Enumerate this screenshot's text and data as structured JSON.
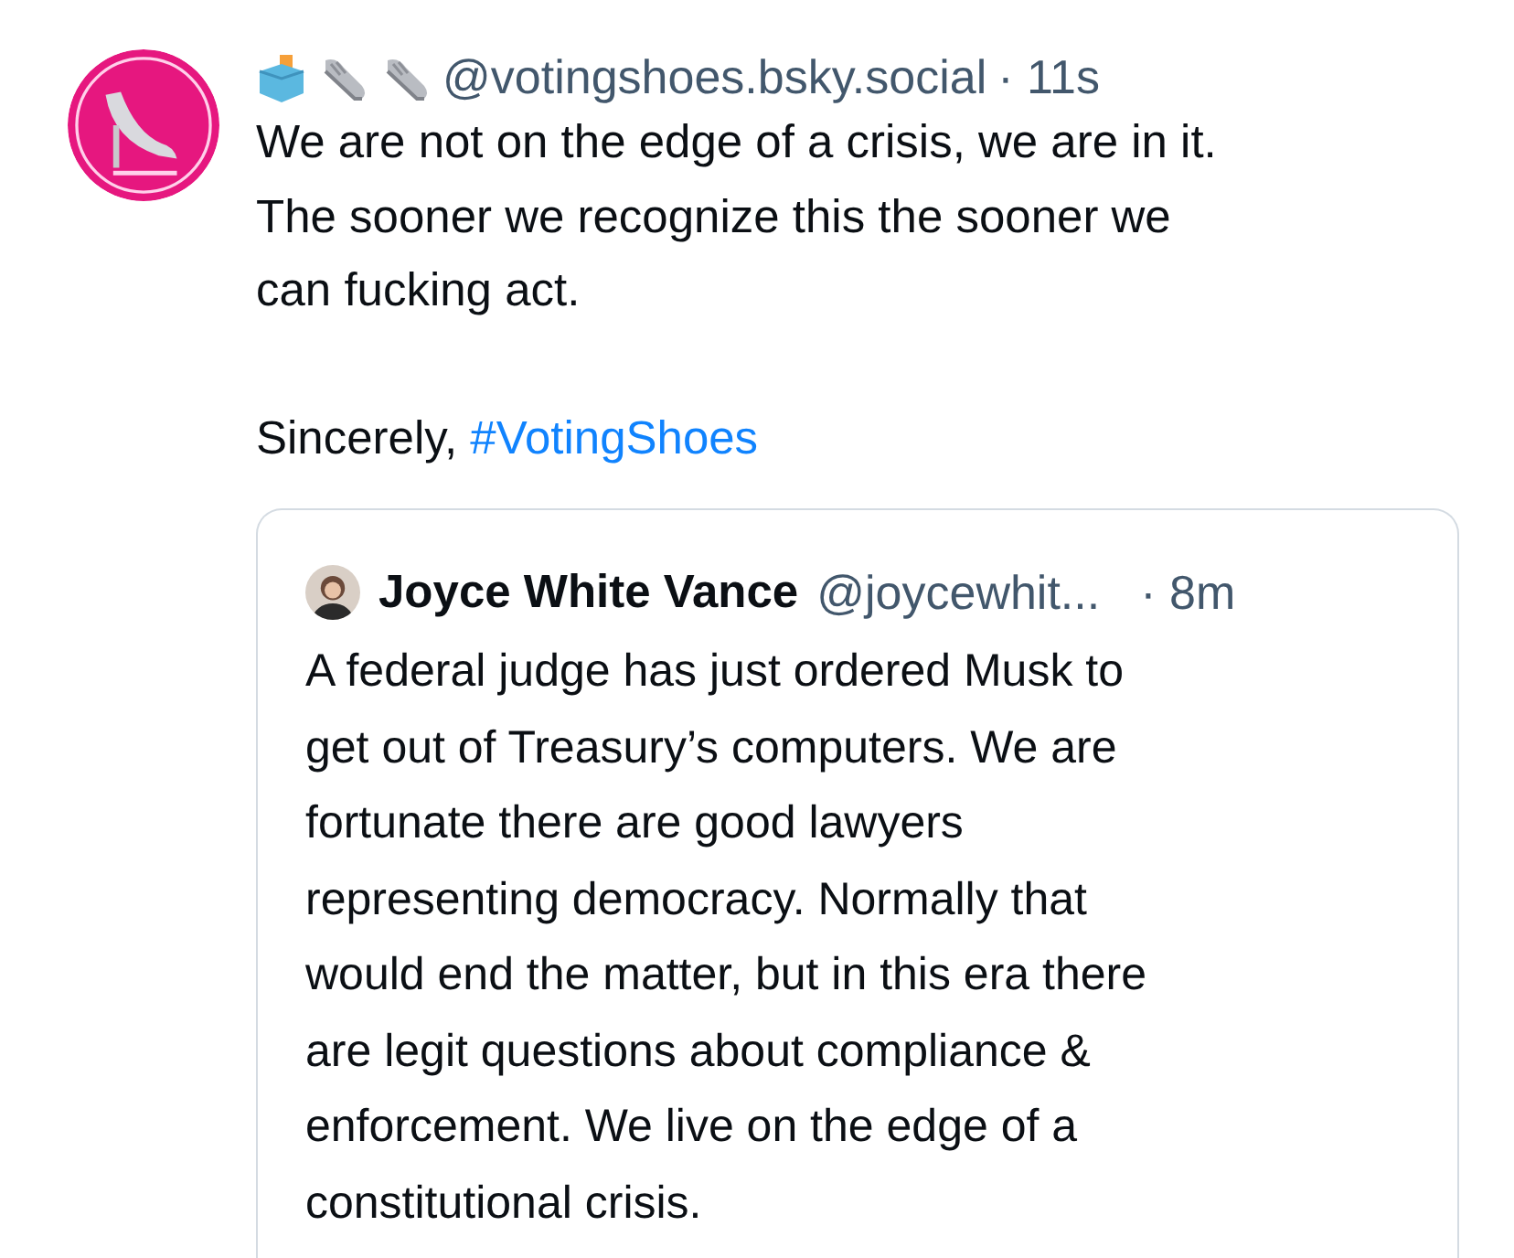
{
  "post": {
    "author": {
      "handle": "@votingshoes.bsky.social",
      "time": "· 11s"
    },
    "text": "We are not on the edge of a crisis, we are in it.\nThe sooner we recognize this the sooner we\ncan fucking act.",
    "signoff": {
      "text": "Sincerely,",
      "hashtag": "#VotingShoes"
    },
    "quote": {
      "name": "Joyce White Vance",
      "handle": "@joycewhit...",
      "time": "· 8m",
      "text": "A federal judge has just ordered Musk to\nget out of Treasury’s computers. We are\nfortunate there are good lawyers\nrepresenting democracy. Normally that\nwould end the matter, but in this era there\nare legit questions about compliance &\nenforcement. We live on the edge of a\nconstitutional crisis."
    }
  }
}
